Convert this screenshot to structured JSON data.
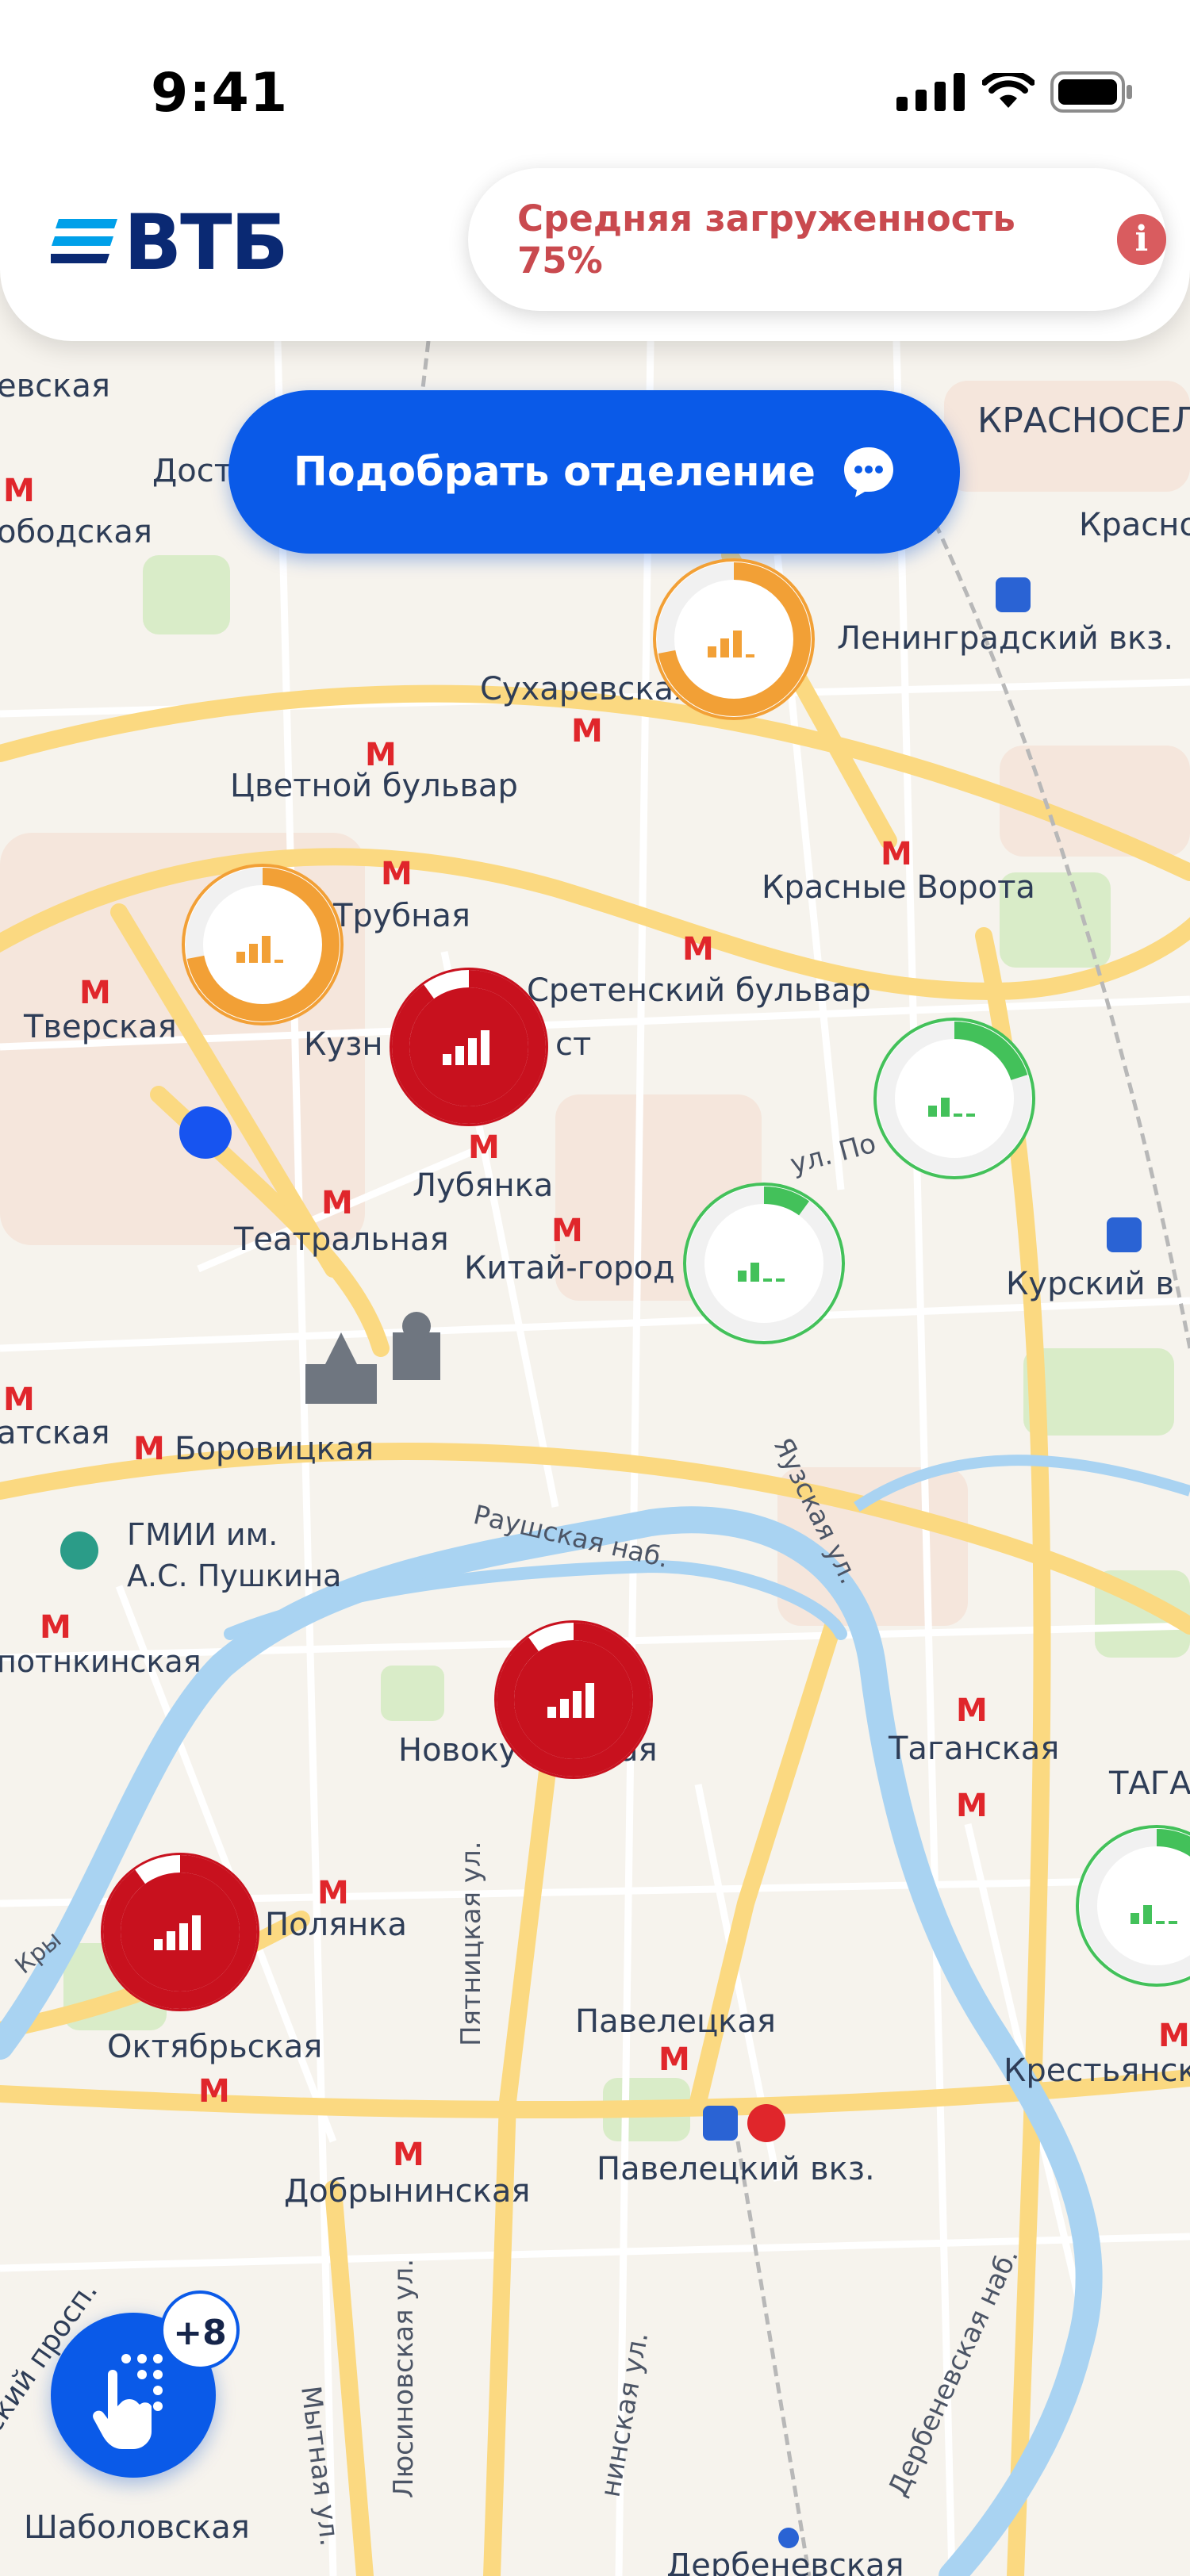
{
  "status_bar": {
    "time": "9:41",
    "icons": [
      "cellular-signal-icon",
      "wifi-icon",
      "battery-icon"
    ]
  },
  "header": {
    "logo_text": "ВТБ",
    "load_label": "Средняя загруженность 75%",
    "load_percent": 75,
    "info_icon": "i"
  },
  "actions": {
    "pick_branch_label": "Подобрать отделение",
    "fab_badge": "+8"
  },
  "colors": {
    "brand_blue": "#0a5ae8",
    "logo_navy": "#0a2973",
    "high_load_red": "#c8111e",
    "medium_load_orange": "#f2a036",
    "low_load_green": "#43c15a"
  },
  "map": {
    "station_labels": [
      "евская",
      "Дост",
      "ободская",
      "КРАСНОСЕЛ",
      "Красно",
      "Ленинградский вкз.",
      "Сухаревская",
      "Цветной бульвар",
      "Красные Ворота",
      "Трубная",
      "Тверская",
      "Кузн",
      "ст",
      "Сретенский бульвар",
      "ул. По",
      "Лубянка",
      "Театральная",
      "Китай-город",
      "Курский в",
      "атская",
      "Боровицкая",
      "Раушская наб.",
      "Яузская ул.",
      "ГМИИ им.",
      "А.С. Пушкина",
      "потнкинская",
      "Новоку",
      "ая",
      "Таганская",
      "ТАГА",
      "Кры",
      "Полянка",
      "Пятницкая ул.",
      "Октябрьская",
      "Павелецкая",
      "Крестьянск",
      "Добрынинская",
      "Павелецкий вкз.",
      "ский просп.",
      "Люсиновская ул.",
      "Мытная ул.",
      "нинская ул.",
      "Дербеневская наб.",
      "Шаболовская",
      "Дербеневская"
    ],
    "branch_markers": [
      {
        "load": "medium",
        "fill": 0.72
      },
      {
        "load": "medium",
        "fill": 0.72
      },
      {
        "load": "high",
        "fill": 0.9
      },
      {
        "load": "high",
        "fill": 0.9
      },
      {
        "load": "high",
        "fill": 0.9
      },
      {
        "load": "low",
        "fill": 0.2
      },
      {
        "load": "low",
        "fill": 0.1
      },
      {
        "load": "low",
        "fill": 0.15
      }
    ]
  }
}
